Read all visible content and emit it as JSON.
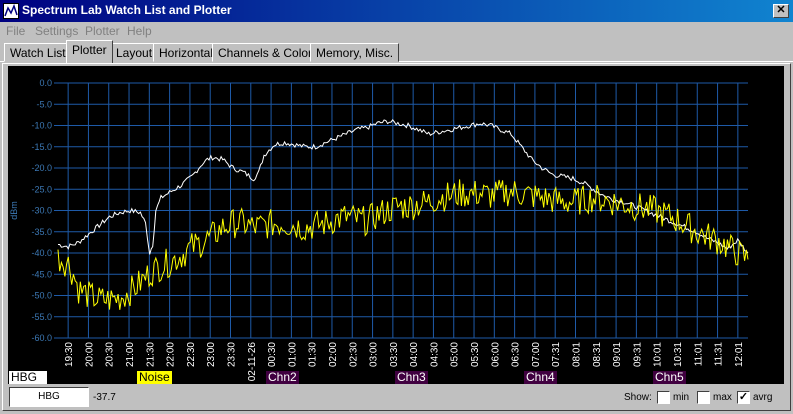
{
  "window": {
    "title": "Spectrum Lab  Watch List and Plotter",
    "close_glyph": "✕",
    "icon": "app-icon"
  },
  "menu": [
    "File",
    "Settings",
    "Plotter",
    "Help"
  ],
  "tabs": [
    {
      "label": "Watch List",
      "active": false
    },
    {
      "label": "Plotter",
      "active": true
    },
    {
      "label": "Layout",
      "active": false
    },
    {
      "label": "Horizontal",
      "active": false
    },
    {
      "label": "Channels & Colors",
      "active": false
    },
    {
      "label": "Memory, Misc.",
      "active": false
    }
  ],
  "chart_data": {
    "type": "line",
    "ylabel": "dBm",
    "ylim": [
      -60,
      0
    ],
    "y_ticks": [
      "0.0",
      "-5.0",
      "-10.0",
      "-15.0",
      "-20.0",
      "-25.0",
      "-30.0",
      "-35.0",
      "-40.0",
      "-45.0",
      "-50.0",
      "-55.0",
      "-60.0"
    ],
    "x_ticks": [
      "19:30",
      "20:00",
      "20:30",
      "21:00",
      "21:30",
      "22:00",
      "22:30",
      "23:00",
      "23:30",
      "02-11-26",
      "00:30",
      "01:00",
      "01:30",
      "02:00",
      "02:30",
      "03:00",
      "03:30",
      "04:00",
      "04:30",
      "05:00",
      "05:30",
      "06:00",
      "06:30",
      "07:00",
      "07:31",
      "08:01",
      "08:31",
      "09:01",
      "09:31",
      "10:01",
      "10:31",
      "11:01",
      "11:31",
      "12:01"
    ],
    "grid": true,
    "colors": {
      "background": "#000000",
      "grid": "#1e5aa8",
      "axis_text": "#3c78b4"
    },
    "series": [
      {
        "name": "HBG",
        "color": "#ffffff",
        "points": [
          [
            0,
            -38.0
          ],
          [
            1,
            -38.5
          ],
          [
            2,
            -37.5
          ],
          [
            3,
            -35.5
          ],
          [
            4,
            -33.5
          ],
          [
            5,
            -31.5
          ],
          [
            6,
            -30.5
          ],
          [
            7,
            -30.0
          ],
          [
            8,
            -30.5
          ],
          [
            8.5,
            -33.0
          ],
          [
            8.9,
            -40.0
          ],
          [
            9.2,
            -38.0
          ],
          [
            9.5,
            -30.0
          ],
          [
            10,
            -27.0
          ],
          [
            11,
            -25.5
          ],
          [
            12,
            -24.0
          ],
          [
            13,
            -22.0
          ],
          [
            14,
            -19.0
          ],
          [
            14.5,
            -18.0
          ],
          [
            15,
            -17.5
          ],
          [
            16,
            -18.0
          ],
          [
            17,
            -20.0
          ],
          [
            18,
            -21.0
          ],
          [
            19,
            -22.5
          ],
          [
            19.5,
            -21.0
          ],
          [
            20,
            -17.0
          ],
          [
            21,
            -14.5
          ],
          [
            22,
            -14.0
          ],
          [
            23,
            -14.5
          ],
          [
            24,
            -15.0
          ],
          [
            25,
            -15.0
          ],
          [
            26,
            -14.0
          ],
          [
            27,
            -13.0
          ],
          [
            28,
            -12.0
          ],
          [
            29,
            -11.0
          ],
          [
            30,
            -10.5
          ],
          [
            31,
            -9.5
          ],
          [
            32,
            -9.0
          ],
          [
            33,
            -9.5
          ],
          [
            34,
            -10.0
          ],
          [
            35,
            -11.0
          ],
          [
            36,
            -12.0
          ],
          [
            37,
            -11.5
          ],
          [
            38,
            -11.0
          ],
          [
            39,
            -10.5
          ],
          [
            40,
            -10.0
          ],
          [
            41,
            -9.5
          ],
          [
            42,
            -10.0
          ],
          [
            43,
            -11.0
          ],
          [
            44,
            -12.0
          ],
          [
            45,
            -15.0
          ],
          [
            46,
            -18.0
          ],
          [
            47,
            -20.0
          ],
          [
            48,
            -21.5
          ],
          [
            49,
            -22.0
          ],
          [
            50,
            -22.5
          ],
          [
            51,
            -23.5
          ],
          [
            52,
            -25.0
          ],
          [
            53,
            -26.5
          ],
          [
            54,
            -27.5
          ],
          [
            55,
            -28.0
          ],
          [
            56,
            -29.0
          ],
          [
            57,
            -30.0
          ],
          [
            58,
            -31.0
          ],
          [
            59,
            -32.0
          ],
          [
            60,
            -33.0
          ],
          [
            61,
            -34.0
          ],
          [
            62,
            -35.0
          ],
          [
            63,
            -36.5
          ],
          [
            64,
            -37.5
          ],
          [
            65,
            -39.0
          ],
          [
            66,
            -37.0
          ],
          [
            67,
            -40.0
          ]
        ]
      },
      {
        "name": "Noise",
        "color": "#ffff00",
        "points": [
          [
            0,
            -41.0
          ],
          [
            1,
            -42.5
          ],
          [
            1.5,
            -45.0
          ],
          [
            2,
            -48.5
          ],
          [
            3,
            -50.0
          ],
          [
            4,
            -51.0
          ],
          [
            5,
            -51.0
          ],
          [
            6,
            -50.5
          ],
          [
            7,
            -49.0
          ],
          [
            8,
            -47.0
          ],
          [
            9,
            -44.5
          ],
          [
            10,
            -43.0
          ],
          [
            11,
            -42.0
          ],
          [
            12,
            -40.5
          ],
          [
            13,
            -38.5
          ],
          [
            14,
            -37.5
          ],
          [
            15,
            -36.0
          ],
          [
            16,
            -34.0
          ],
          [
            17,
            -33.0
          ],
          [
            18,
            -33.0
          ],
          [
            19,
            -34.0
          ],
          [
            20,
            -33.5
          ],
          [
            21,
            -33.0
          ],
          [
            22,
            -33.0
          ],
          [
            23,
            -33.5
          ],
          [
            24,
            -34.0
          ],
          [
            25,
            -33.5
          ],
          [
            26,
            -33.0
          ],
          [
            27,
            -32.0
          ],
          [
            28,
            -31.5
          ],
          [
            29,
            -32.0
          ],
          [
            30,
            -32.5
          ],
          [
            31,
            -31.0
          ],
          [
            32,
            -30.0
          ],
          [
            33,
            -29.0
          ],
          [
            34,
            -29.0
          ],
          [
            35,
            -28.5
          ],
          [
            36,
            -28.0
          ],
          [
            37,
            -27.0
          ],
          [
            38,
            -26.5
          ],
          [
            39,
            -26.0
          ],
          [
            40,
            -26.0
          ],
          [
            41,
            -26.0
          ],
          [
            42,
            -26.5
          ],
          [
            43,
            -26.0
          ],
          [
            44,
            -25.5
          ],
          [
            45,
            -26.0
          ],
          [
            46,
            -26.5
          ],
          [
            47,
            -27.0
          ],
          [
            48,
            -27.5
          ],
          [
            49,
            -28.0
          ],
          [
            50,
            -28.0
          ],
          [
            51,
            -27.5
          ],
          [
            52,
            -27.0
          ],
          [
            53,
            -27.5
          ],
          [
            54,
            -28.0
          ],
          [
            55,
            -28.5
          ],
          [
            56,
            -29.0
          ],
          [
            57,
            -29.5
          ],
          [
            58,
            -30.0
          ],
          [
            59,
            -31.0
          ],
          [
            60,
            -32.0
          ],
          [
            61,
            -33.5
          ],
          [
            62,
            -35.0
          ],
          [
            63,
            -36.0
          ],
          [
            64,
            -37.0
          ],
          [
            65,
            -38.5
          ],
          [
            66,
            -40.0
          ],
          [
            67,
            -41.5
          ]
        ]
      }
    ]
  },
  "channels": [
    {
      "name": "HBG",
      "bg": "#ffffff",
      "fg": "#000000"
    },
    {
      "name": "Noise",
      "bg": "#ffff00",
      "fg": "#000000"
    },
    {
      "name": "Chn2",
      "bg": "#400040",
      "fg": "#ffffff"
    },
    {
      "name": "Chn3",
      "bg": "#400040",
      "fg": "#ffffff"
    },
    {
      "name": "Chn4",
      "bg": "#400040",
      "fg": "#ffffff"
    },
    {
      "name": "Chn5",
      "bg": "#400040",
      "fg": "#ffffff"
    }
  ],
  "status": {
    "selected_channel": "HBG",
    "value": "-37.7",
    "show_label": "Show:",
    "min_label": "min",
    "max_label": "max",
    "avrg_label": "avrg",
    "min_checked": false,
    "max_checked": false,
    "avrg_checked": true,
    "check_glyph": "✓"
  }
}
